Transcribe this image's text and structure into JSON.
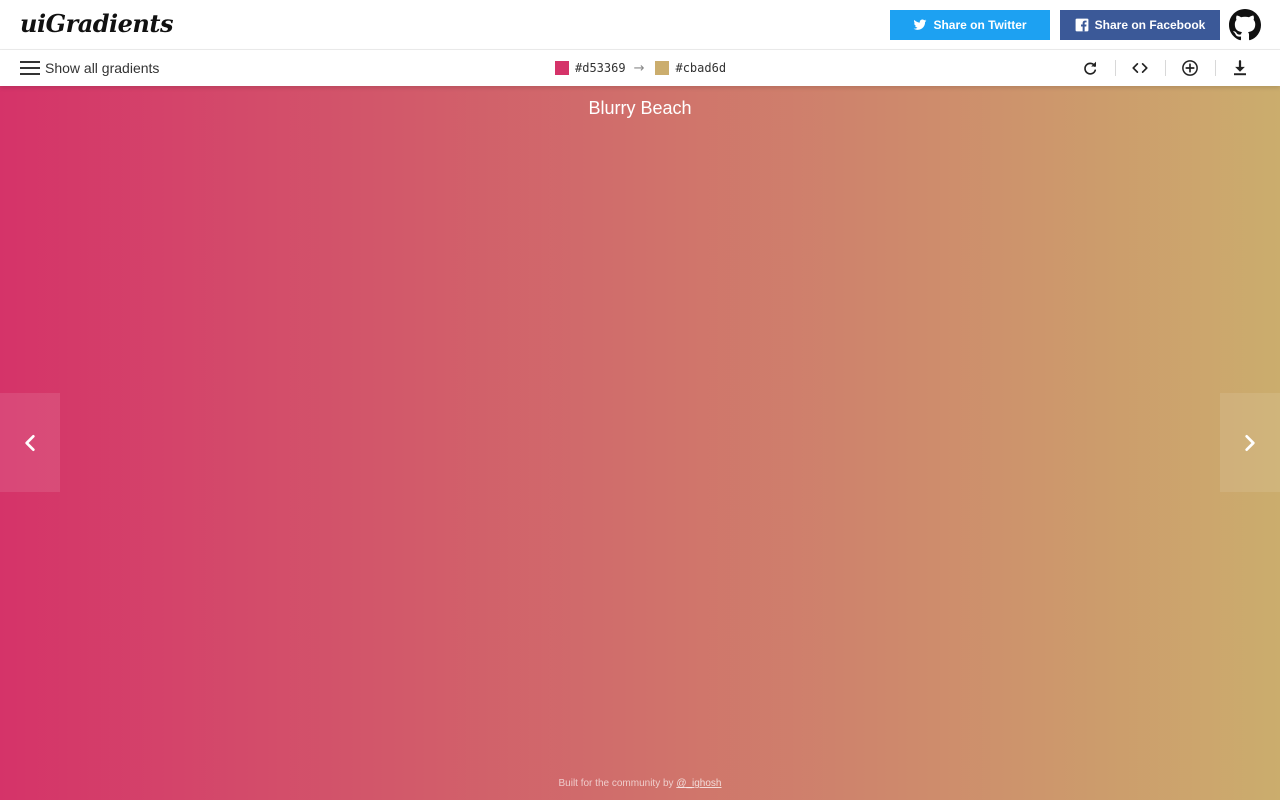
{
  "header": {
    "logo": "uiGradients",
    "twitter_label": "Share on Twitter",
    "facebook_label": "Share on Facebook",
    "github_icon": "github-icon"
  },
  "toolbar": {
    "show_all_label": "Show all gradients",
    "color_from": "#d53369",
    "arrow": "→",
    "color_to": "#cbad6d",
    "actions": [
      "rotate-icon",
      "code-icon",
      "add-icon",
      "download-icon"
    ]
  },
  "gradient": {
    "name": "Blurry Beach",
    "from": "#d53369",
    "to": "#cbad6d"
  },
  "nav": {
    "prev_icon": "chevron-left-icon",
    "next_icon": "chevron-right-icon"
  },
  "footer": {
    "text": "Built for the community by",
    "author": "@_ighosh"
  },
  "colors": {
    "twitter": "#1da1f2",
    "facebook": "#3b5998"
  }
}
